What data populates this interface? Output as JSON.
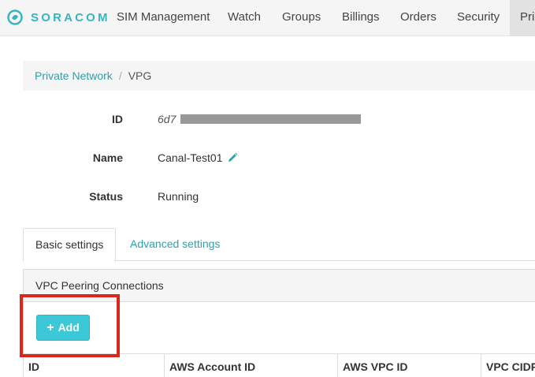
{
  "brand": {
    "name": "SORACOM",
    "color": "#34b5c0"
  },
  "nav": {
    "items": [
      "SIM Management",
      "Watch",
      "Groups",
      "Billings",
      "Orders",
      "Security",
      "Pri"
    ]
  },
  "breadcrumb": {
    "parent": "Private Network",
    "separator": "/",
    "current": "VPG"
  },
  "details": {
    "id_label": "ID",
    "id_value": "6d7",
    "name_label": "Name",
    "name_value": "Canal-Test01",
    "status_label": "Status",
    "status_value": "Running"
  },
  "tabs": [
    "Basic settings",
    "Advanced settings"
  ],
  "panel": {
    "title": "VPC Peering Connections",
    "add_label": "Add",
    "columns": [
      "ID",
      "AWS Account ID",
      "AWS VPC ID",
      "VPC CIDR"
    ]
  },
  "colors": {
    "accent": "#2aa3ae",
    "button": "#3cc8d6",
    "highlight": "#d8271c"
  },
  "icons": {
    "edit": "pencil-icon",
    "add": "plus-icon"
  }
}
